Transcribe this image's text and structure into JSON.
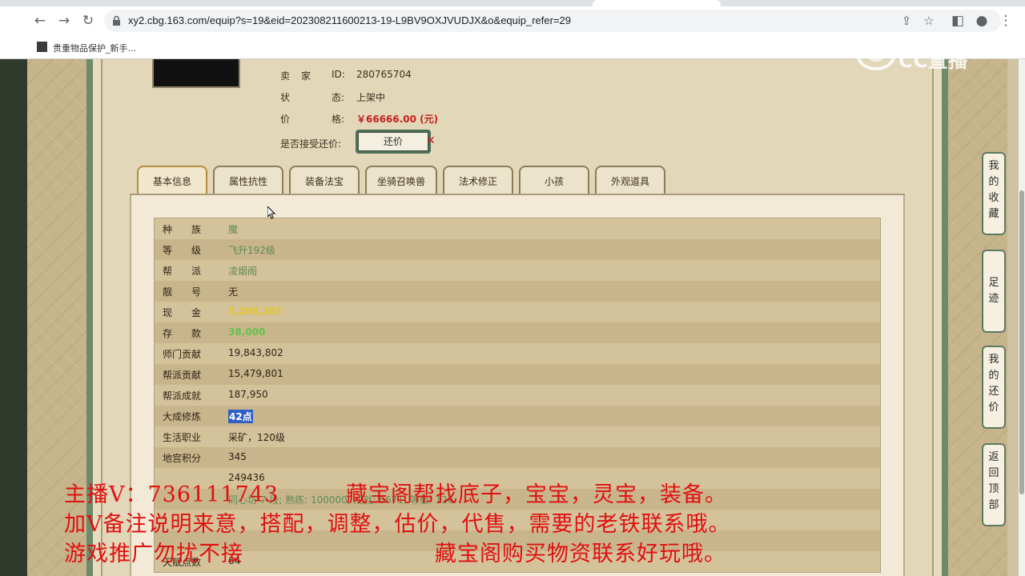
{
  "browser": {
    "url": "xy2.cbg.163.com/equip?s=19&eid=202308211600213-19-L9BV9OXJVUDJX&o&equip_refer=29",
    "bookmark_label": "贵重物品保护_新手..."
  },
  "seller": {
    "id_label_a": "卖",
    "id_label_b": "家",
    "id_key": "ID:",
    "id_value": "280765704",
    "status_label_a": "状",
    "status_label_b": "态:",
    "status_value": "上架中",
    "price_label_a": "价",
    "price_label_b": "格:",
    "price_value": "￥66666.00 (元)",
    "bargain_label": "是否接受还价:",
    "bargain_button": "还价",
    "bargain_mark": "✕"
  },
  "tabs": [
    "基本信息",
    "属性抗性",
    "装备法宝",
    "坐骑召唤兽",
    "法术修正",
    "小孩",
    "外观道具"
  ],
  "rows": [
    {
      "label": "种　　族",
      "value": "魔",
      "style": "v-green"
    },
    {
      "label": "等　　级",
      "value": "飞升192级",
      "style": "v-green"
    },
    {
      "label": "帮　　派",
      "value": "凌烟阁",
      "style": "v-green"
    },
    {
      "label": "靓　　号",
      "value": "无",
      "style": "v-dark"
    },
    {
      "label": "现　　金",
      "value": "5,208,287",
      "style": "v-yellow"
    },
    {
      "label": "存　　款",
      "value": "38,000",
      "style": "v-bright"
    },
    {
      "label": "师门贡献",
      "value": "19,843,802",
      "style": "v-dark"
    },
    {
      "label": "帮派贡献",
      "value": "15,479,801",
      "style": "v-dark"
    },
    {
      "label": "帮派成就",
      "value": "187,950",
      "style": "v-dark"
    },
    {
      "label": "大成修炼",
      "value": "42点",
      "style": "v-selected"
    },
    {
      "label": "生活职业",
      "value": "采矿，120级",
      "style": "v-dark"
    },
    {
      "label": "地宫积分",
      "value": "345",
      "style": "v-dark"
    },
    {
      "label": "",
      "value": "249436",
      "style": "v-dark"
    },
    {
      "label": "",
      "value": "同心坊 7 段; 熟练: 100000; 成就: 5671; 等级: 126",
      "style": "v-green"
    },
    {
      "label": "",
      "value": "",
      "style": "v-dark"
    },
    {
      "label": "",
      "value": "",
      "style": "v-dark"
    },
    {
      "label": "天赋点数",
      "value": "64",
      "style": "v-dark"
    }
  ],
  "sidebar": {
    "favorites": "我的收藏",
    "footprints": "足迹",
    "my_bargains": "我的还价",
    "back_to_top": "返回顶部"
  },
  "watermark": {
    "text": "CC直播"
  },
  "overlay": {
    "line1_a": "主播V：736111743",
    "line1_b": "藏宝阁帮找底子，宝宝，灵宝，装备。",
    "line2": "加V备注说明来意，搭配，调整，估价，代售，需要的老铁联系哦。",
    "line3_a": "游戏推广勿扰不接",
    "line3_b": "藏宝阁购买物资联系好玩哦。"
  },
  "colors": {
    "accent_red": "#c41f1f",
    "overlay_red": "#e01010",
    "frame_green": "#6d8a6b"
  }
}
